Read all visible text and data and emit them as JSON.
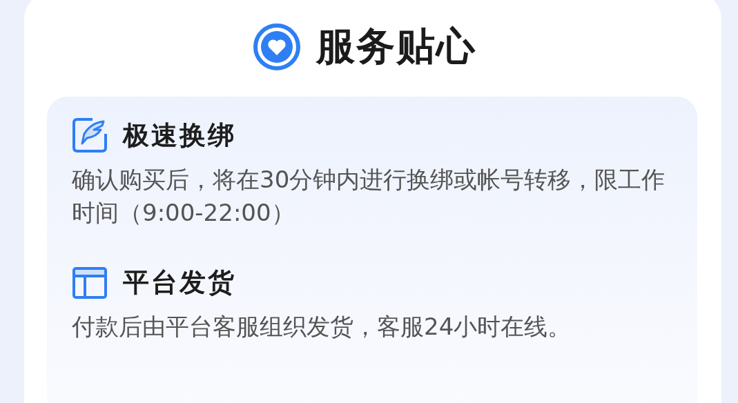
{
  "header": {
    "title": "服务贴心"
  },
  "features": [
    {
      "kind": "swap",
      "title": "极速换绑",
      "description": "确认购买后，将在30分钟内进行换绑或帐号转移，限工作时间（9:00-22:00）"
    },
    {
      "kind": "delivery",
      "title": "平台发货",
      "description": "付款后由平台客服组织发货，客服24小时在线。"
    }
  ]
}
